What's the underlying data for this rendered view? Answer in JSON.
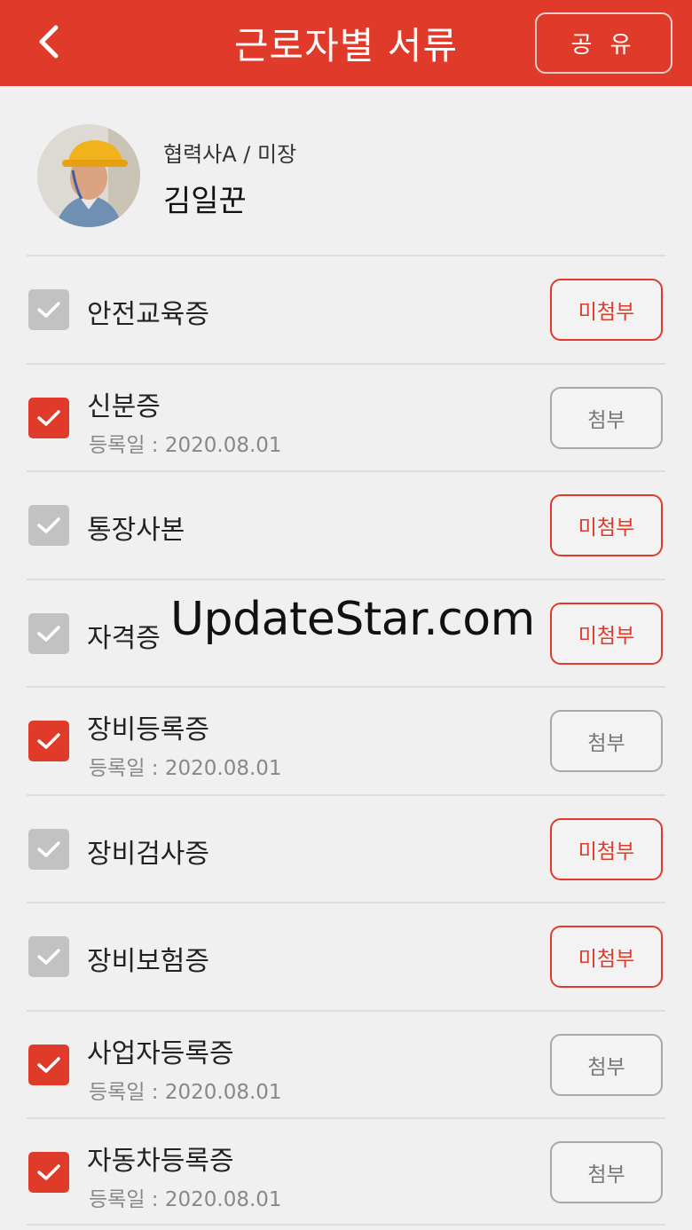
{
  "header": {
    "title": "근로자별 서류",
    "share_label": "공 유",
    "background_color": "#e03a2a"
  },
  "profile": {
    "org_role": "협력사A / 미장",
    "name": "김일꾼"
  },
  "documents": [
    {
      "title": "안전교육증",
      "checked": false,
      "status": "미첨부",
      "date": ""
    },
    {
      "title": "신분증",
      "checked": true,
      "status": "첨부",
      "date": "등록일 : 2020.08.01"
    },
    {
      "title": "통장사본",
      "checked": false,
      "status": "미첨부",
      "date": ""
    },
    {
      "title": "자격증",
      "checked": false,
      "status": "미첨부",
      "date": ""
    },
    {
      "title": "장비등록증",
      "checked": true,
      "status": "첨부",
      "date": "등록일 : 2020.08.01"
    },
    {
      "title": "장비검사증",
      "checked": false,
      "status": "미첨부",
      "date": ""
    },
    {
      "title": "장비보험증",
      "checked": false,
      "status": "미첨부",
      "date": ""
    },
    {
      "title": "사업자등록증",
      "checked": true,
      "status": "첨부",
      "date": "등록일 : 2020.08.01"
    },
    {
      "title": "자동차등록증",
      "checked": true,
      "status": "첨부",
      "date": "등록일 : 2020.08.01"
    }
  ],
  "watermark": "UpdateStar.com",
  "colors": {
    "accent": "#e03a2a",
    "unchecked": "#c2c2c2",
    "attached_border": "#a8a8a8"
  }
}
